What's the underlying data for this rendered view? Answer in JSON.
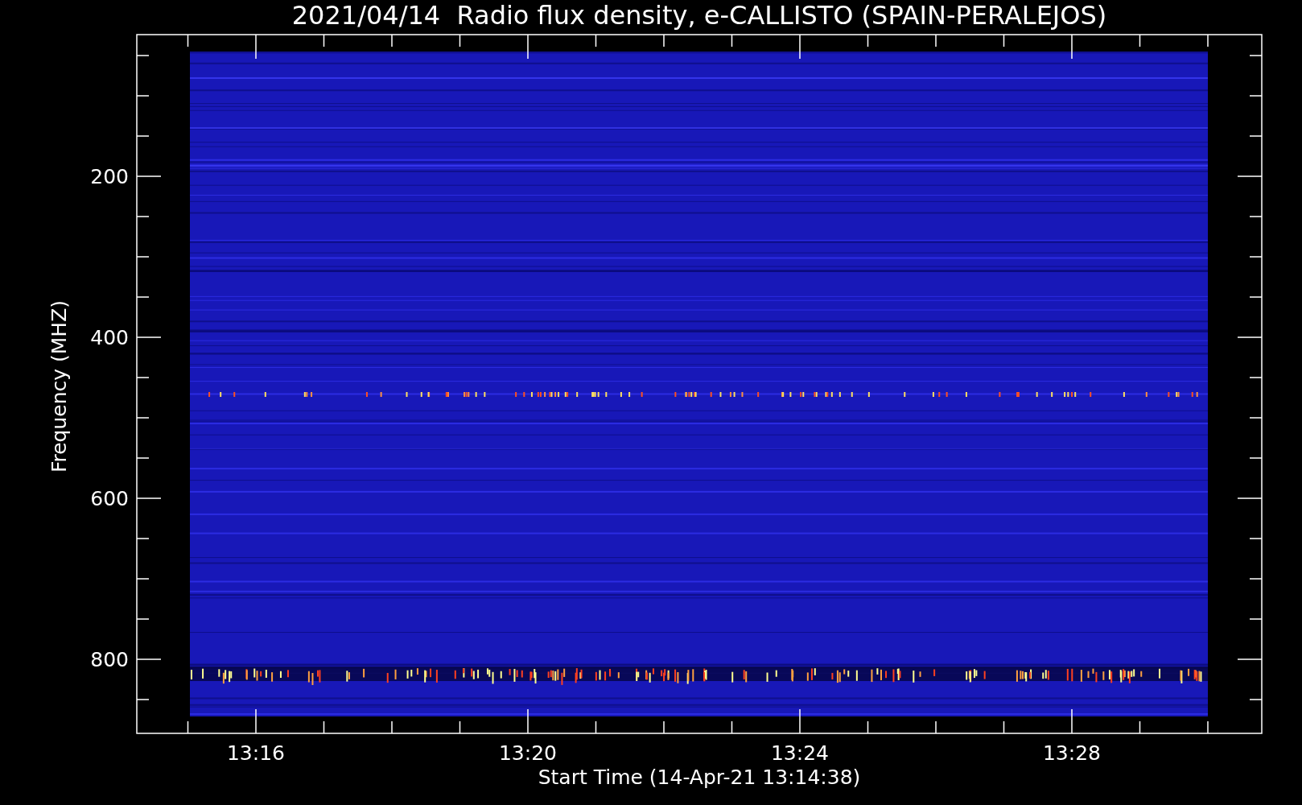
{
  "title": "2021/04/14  Radio flux density, e-CALLISTO (SPAIN-PERALEJOS)",
  "y_axis": {
    "label": "Frequency (MHZ)",
    "ticks": [
      "200",
      "400",
      "600",
      "800"
    ]
  },
  "x_axis": {
    "label": "Start Time (14-Apr-21 13:14:38)",
    "ticks": [
      "13:16",
      "13:20",
      "13:24",
      "13:28"
    ]
  }
}
